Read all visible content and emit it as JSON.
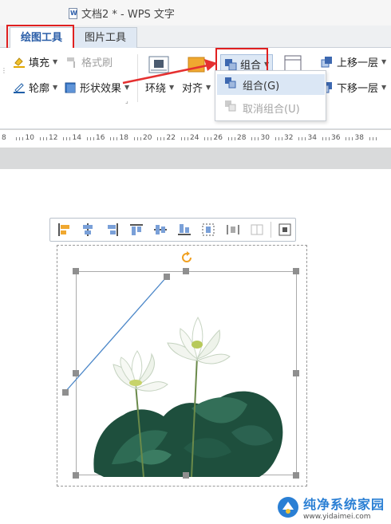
{
  "window": {
    "title": "文档2 * - WPS 文字"
  },
  "tabs": [
    {
      "label": "绘图工具"
    },
    {
      "label": "图片工具"
    }
  ],
  "ribbon": {
    "fill_label": "填充",
    "format_painter_label": "格式刷",
    "outline_label": "轮廓",
    "shape_effects_label": "形状效果",
    "wrap_label": "环绕",
    "align_label": "对齐",
    "group_label": "组合",
    "bring_forward_label": "上移一层",
    "send_backward_label": "下移一层"
  },
  "group_menu": {
    "items": [
      {
        "label": "组合(G)",
        "enabled": true
      },
      {
        "label": "取消组合(U)",
        "enabled": false
      }
    ]
  },
  "ruler": {
    "labels": [
      "8",
      "10",
      "12",
      "14",
      "16",
      "18",
      "20",
      "22",
      "24",
      "26",
      "28",
      "30",
      "32",
      "34",
      "36",
      "38"
    ]
  },
  "watermark": {
    "title": "纯净系统家园",
    "url": "www.yidaimei.com"
  },
  "colors": {
    "highlight_red": "#e02020",
    "accent_blue": "#2a5ea8",
    "menu_hover": "#dbe7f5"
  }
}
